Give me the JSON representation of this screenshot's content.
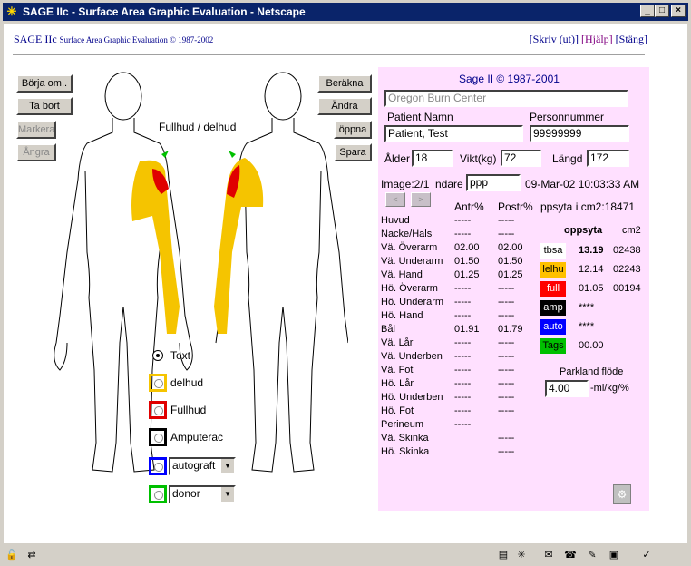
{
  "window": {
    "title": "SAGE IIc - Surface Area Graphic Evaluation - Netscape"
  },
  "header": {
    "title_main": "SAGE IIc",
    "title_sub": "Surface Area Graphic Evaluation © 1987-2002",
    "link_print": "[Skriv (ut)]",
    "link_help": "[Hjälp]",
    "link_close": "[Stäng]"
  },
  "left_buttons": {
    "restart": "Börja om..",
    "remove": "Ta bort",
    "mark": "Markera",
    "undo": "Ångra"
  },
  "right_buttons": {
    "calc": "Beräkna",
    "change": "Ändra",
    "open": "öppna",
    "save": "Spara"
  },
  "figure_label": "Fullhud / delhud",
  "legend": {
    "text": "Text",
    "partial": "delhud",
    "full": "Fullhud",
    "amputated": "Amputerac",
    "autograft_value": "autograft",
    "donor_value": "donor"
  },
  "panel": {
    "copyright": "Sage II © 1987-2001",
    "center": "Oregon Burn Center",
    "patient_name_label": "Patient Namn",
    "patient_name": "Patient, Test",
    "person_number_label": "Personnummer",
    "person_number": "99999999",
    "age_label": "Ålder",
    "age": "18",
    "weight_label": "Vikt(kg)",
    "weight": "72",
    "height_label": "Längd",
    "height": "172",
    "image_label": "Image:2/1",
    "user_label": "ndare",
    "user": "ppp",
    "datetime": "09-Mar-02 10:03:33 AM",
    "nav_prev": "<",
    "nav_next": ">",
    "col_ant": "Antr%",
    "col_post": "Postr%",
    "col_area": "ppsyta i cm2:18471",
    "rows": [
      {
        "name": "Huvud",
        "ant": "-----",
        "post": "-----"
      },
      {
        "name": "Nacke/Hals",
        "ant": "-----",
        "post": "-----"
      },
      {
        "name": "Vä. Överarm",
        "ant": "02.00",
        "post": "02.00"
      },
      {
        "name": "Vä. Underarm",
        "ant": "01.50",
        "post": "01.50"
      },
      {
        "name": "Vä. Hand",
        "ant": "01.25",
        "post": "01.25"
      },
      {
        "name": "Hö. Överarm",
        "ant": "-----",
        "post": "-----"
      },
      {
        "name": "Hö. Underarm",
        "ant": "-----",
        "post": "-----"
      },
      {
        "name": "Hö. Hand",
        "ant": "-----",
        "post": "-----"
      },
      {
        "name": "Bål",
        "ant": "01.91",
        "post": "01.79"
      },
      {
        "name": "Vä. Lår",
        "ant": "-----",
        "post": "-----"
      },
      {
        "name": "Vä. Underben",
        "ant": "-----",
        "post": "-----"
      },
      {
        "name": "Vä. Fot",
        "ant": "-----",
        "post": "-----"
      },
      {
        "name": "Hö. Lår",
        "ant": "-----",
        "post": "-----"
      },
      {
        "name": "Hö. Underben",
        "ant": "-----",
        "post": "-----"
      },
      {
        "name": "Hö. Fot",
        "ant": "-----",
        "post": "-----"
      },
      {
        "name": "Perineum",
        "ant": "-----",
        "post": ""
      },
      {
        "name": "Vä. Skinka",
        "ant": "",
        "post": "-----"
      },
      {
        "name": "Hö. Skinka",
        "ant": "",
        "post": "-----"
      }
    ],
    "summary_head": "oppsyta",
    "summary_unit": "cm2",
    "summary": [
      {
        "tag": "tbsa",
        "pct": "13.19",
        "cm2": "02438",
        "bg": "#ffffff",
        "fg": "#000000"
      },
      {
        "tag": "lelhu",
        "pct": "12.14",
        "cm2": "02243",
        "bg": "#ffc000",
        "fg": "#000000"
      },
      {
        "tag": "full",
        "pct": "01.05",
        "cm2": "00194",
        "bg": "#ff0000",
        "fg": "#ffffff"
      },
      {
        "tag": "amp",
        "pct": "****",
        "cm2": "",
        "bg": "#000000",
        "fg": "#ffffff"
      },
      {
        "tag": "auto",
        "pct": "****",
        "cm2": "",
        "bg": "#0000ff",
        "fg": "#ffffff"
      },
      {
        "tag": "Tags",
        "pct": "00.00",
        "cm2": "",
        "bg": "#00c000",
        "fg": "#000000"
      }
    ],
    "parkland_label": "Parkland flöde",
    "parkland_value": "4.00",
    "parkland_unit": "-ml/kg/%"
  },
  "colors": {
    "partial": "#f5c400",
    "full": "#e00000",
    "panel": "#ffe0ff",
    "titlebar": "#0a246a"
  }
}
